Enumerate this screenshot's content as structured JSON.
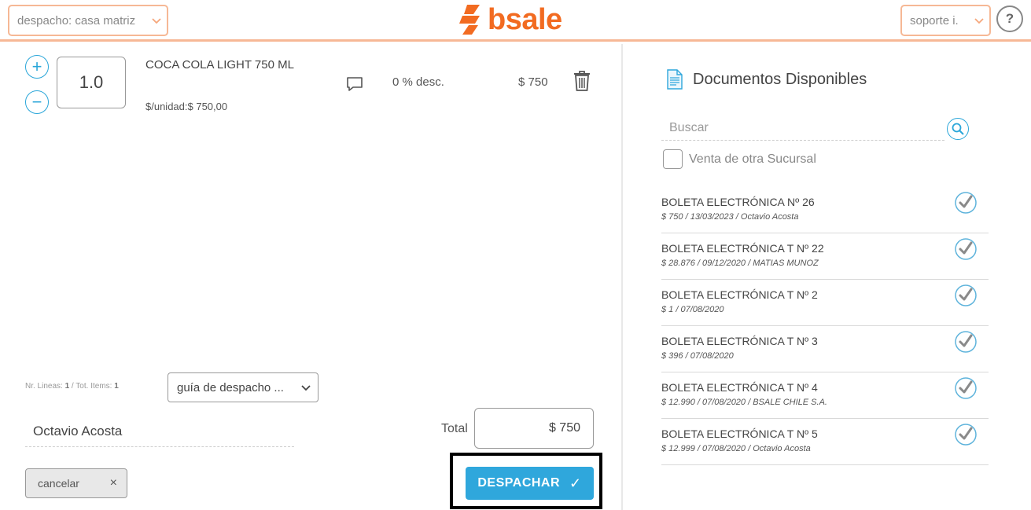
{
  "header": {
    "branch_select": "despacho: casa matriz",
    "logo_text": "bsale",
    "support_select": "soporte i.",
    "help_label": "?"
  },
  "line_item": {
    "quantity": "1.0",
    "plus_label": "+",
    "minus_label": "−",
    "name": "COCA COLA LIGHT 750 ML",
    "unit_price": "$/unidad:$ 750,00",
    "discount": "0 % desc.",
    "total": "$ 750"
  },
  "footer": {
    "counts_prefix": "Nr. Lineas: ",
    "lines_count": "1",
    "counts_mid": " / Tot. Items: ",
    "items_count": "1",
    "document_type": "guía de despacho ...",
    "seller": "Octavio Acosta",
    "total_label": "Total",
    "total_value": "$ 750",
    "cancel_label": "cancelar",
    "cancel_x": "×",
    "dispatch_label": "DESPACHAR",
    "dispatch_check": "✓"
  },
  "documents": {
    "title": "Documentos Disponibles",
    "search_placeholder": "Buscar",
    "other_branch_label": "Venta de otra Sucursal",
    "items": [
      {
        "title": "BOLETA ELECTRÓNICA Nº 26",
        "subtitle": "$ 750 / 13/03/2023 / Octavio Acosta"
      },
      {
        "title": "BOLETA ELECTRÓNICA T Nº 22",
        "subtitle": "$ 28.876 / 09/12/2020 / MATIAS MUNOZ"
      },
      {
        "title": "BOLETA ELECTRÓNICA T Nº 2",
        "subtitle": "$ 1 / 07/08/2020"
      },
      {
        "title": "BOLETA ELECTRÓNICA T Nº 3",
        "subtitle": "$ 396 / 07/08/2020"
      },
      {
        "title": "BOLETA ELECTRÓNICA T Nº 4",
        "subtitle": "$ 12.990 / 07/08/2020 / BSALE CHILE S.A."
      },
      {
        "title": "BOLETA ELECTRÓNICA T Nº 5",
        "subtitle": "$ 12.999 / 07/08/2020 / Octavio Acosta"
      }
    ]
  },
  "colors": {
    "brand_orange": "#f26b21",
    "accent_blue": "#2fa7dc",
    "header_border": "#f7b896"
  }
}
